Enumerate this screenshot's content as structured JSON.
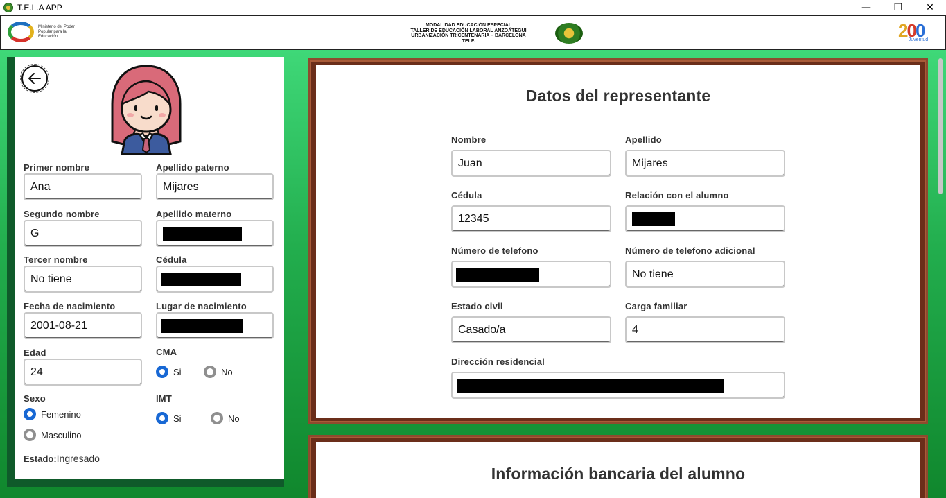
{
  "window": {
    "title": "T.E.L.A APP",
    "minimize_icon": "—",
    "maximize_icon": "❐",
    "close_icon": "✕"
  },
  "header": {
    "ministry_text": "Ministerio del Poder Popular para la Educación",
    "school_lines": [
      "MODALIDAD EDUCACIÓN ESPECIAL",
      "TALLER DE EDUCACIÓN LABORAL ANZOÁTEGUI",
      "URBANIZACIÓN TRICENTENARIA – BARCELONA",
      "TELF."
    ],
    "anniversary_caption": "Juventud"
  },
  "student": {
    "primer_nombre": {
      "label": "Primer nombre",
      "value": "Ana"
    },
    "apellido_paterno": {
      "label": "Apellido paterno",
      "value": "Mijares"
    },
    "segundo_nombre": {
      "label": "Segundo nombre",
      "value": "G"
    },
    "apellido_materno": {
      "label": "Apellido materno",
      "value": ""
    },
    "tercer_nombre": {
      "label": "Tercer nombre",
      "value": "No tiene"
    },
    "cedula": {
      "label": "Cédula",
      "value": ""
    },
    "fecha_nacimiento": {
      "label": "Fecha de nacimiento",
      "value": "2001-08-21"
    },
    "lugar_nacimiento": {
      "label": "Lugar de nacimiento",
      "value": ""
    },
    "edad": {
      "label": "Edad",
      "value": "24"
    },
    "cma": {
      "label": "CMA",
      "options": [
        "Si",
        "No"
      ],
      "selected": "Si"
    },
    "sexo": {
      "label": "Sexo",
      "options": [
        "Femenino",
        "Masculino"
      ],
      "selected": "Femenino"
    },
    "imt": {
      "label": "IMT",
      "options": [
        "Si",
        "No"
      ],
      "selected": "Si"
    },
    "estado_label": "Estado:",
    "estado_value": "Ingresado"
  },
  "representante": {
    "title": "Datos del representante",
    "nombre": {
      "label": "Nombre",
      "value": "Juan"
    },
    "apellido": {
      "label": "Apellido",
      "value": "Mijares"
    },
    "cedula": {
      "label": "Cédula",
      "value": "12345"
    },
    "relacion": {
      "label": "Relación con el alumno",
      "value": ""
    },
    "telefono": {
      "label": "Número de telefono",
      "value": ""
    },
    "telefono_adicional": {
      "label": "Número de telefono adicional",
      "value": "No tiene"
    },
    "estado_civil": {
      "label": "Estado civil",
      "value": "Casado/a"
    },
    "carga_familiar": {
      "label": "Carga familiar",
      "value": "4"
    },
    "direccion": {
      "label": "Dirección residencial",
      "value": ""
    }
  },
  "bancaria": {
    "title": "Información bancaria del alumno"
  },
  "colors": {
    "accent_radio": "#1868d4",
    "panel_frame": "#6b2e1a",
    "green_dark": "#0f5a2a",
    "green_light": "#3fd878"
  }
}
